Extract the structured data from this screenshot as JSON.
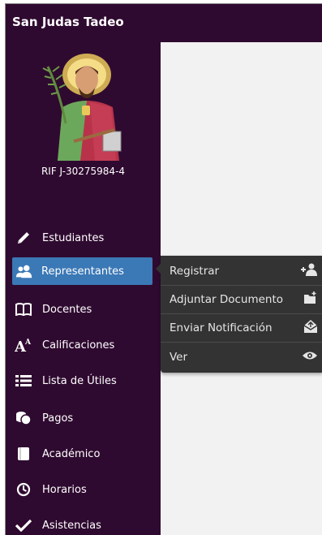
{
  "brand": {
    "title": "San Judas Tadeo"
  },
  "sidebar": {
    "rif": "RIF J-30275984-4",
    "items": [
      {
        "label": "Estudiantes",
        "icon": "pencil-icon"
      },
      {
        "label": "Representantes",
        "icon": "users-icon"
      },
      {
        "label": "Docentes",
        "icon": "book-open-icon"
      },
      {
        "label": "Calificaciones",
        "icon": "font-size-icon"
      },
      {
        "label": "Lista de Útiles",
        "icon": "list-icon"
      },
      {
        "label": "Pagos",
        "icon": "coins-icon"
      },
      {
        "label": "Académico",
        "icon": "book-icon"
      },
      {
        "label": "Horarios",
        "icon": "clock-icon"
      },
      {
        "label": "Asistencias",
        "icon": "check-icon"
      }
    ]
  },
  "submenu": {
    "items": [
      {
        "label": "Registrar",
        "icon": "user-plus-icon"
      },
      {
        "label": "Adjuntar Documento",
        "icon": "folder-plus-icon"
      },
      {
        "label": "Enviar Notificación",
        "icon": "envelope-open-icon"
      },
      {
        "label": "Ver",
        "icon": "eye-icon"
      }
    ]
  },
  "colors": {
    "sidebar_bg": "#2f0a30",
    "active_bg": "#3b78b6",
    "submenu_bg": "#333333",
    "content_bg": "#f2f2f2"
  }
}
